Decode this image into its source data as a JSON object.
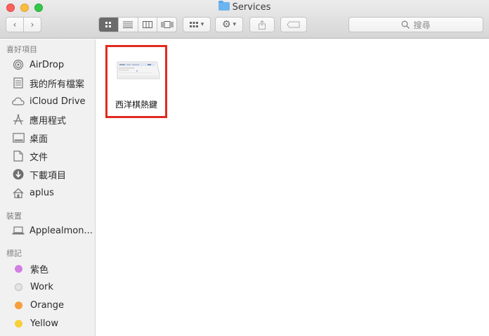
{
  "window": {
    "title": "Services"
  },
  "toolbar": {
    "back_icon": "chevron-left-icon",
    "forward_icon": "chevron-right-icon",
    "search_placeholder": "搜尋"
  },
  "sidebar": {
    "favorites_title": "喜好項目",
    "favorites": [
      {
        "label": "AirDrop",
        "icon": "airdrop-icon"
      },
      {
        "label": "我的所有檔案",
        "icon": "all-files-icon"
      },
      {
        "label": "iCloud Drive",
        "icon": "cloud-icon"
      },
      {
        "label": "應用程式",
        "icon": "applications-icon"
      },
      {
        "label": "桌面",
        "icon": "desktop-icon"
      },
      {
        "label": "文件",
        "icon": "document-icon"
      },
      {
        "label": "下載項目",
        "icon": "download-icon"
      },
      {
        "label": "aplus",
        "icon": "home-icon"
      }
    ],
    "devices_title": "裝置",
    "devices": [
      {
        "label": "Applealmon...",
        "icon": "laptop-icon"
      }
    ],
    "tags_title": "標記",
    "tags": [
      {
        "label": "紫色",
        "color": "#d17ee3"
      },
      {
        "label": "Work",
        "color": "#e0e0e0"
      },
      {
        "label": "Orange",
        "color": "#f5a03c"
      },
      {
        "label": "Yellow",
        "color": "#f7d03b"
      }
    ]
  },
  "main": {
    "files": [
      {
        "name": "西洋棋熱鍵"
      }
    ]
  }
}
